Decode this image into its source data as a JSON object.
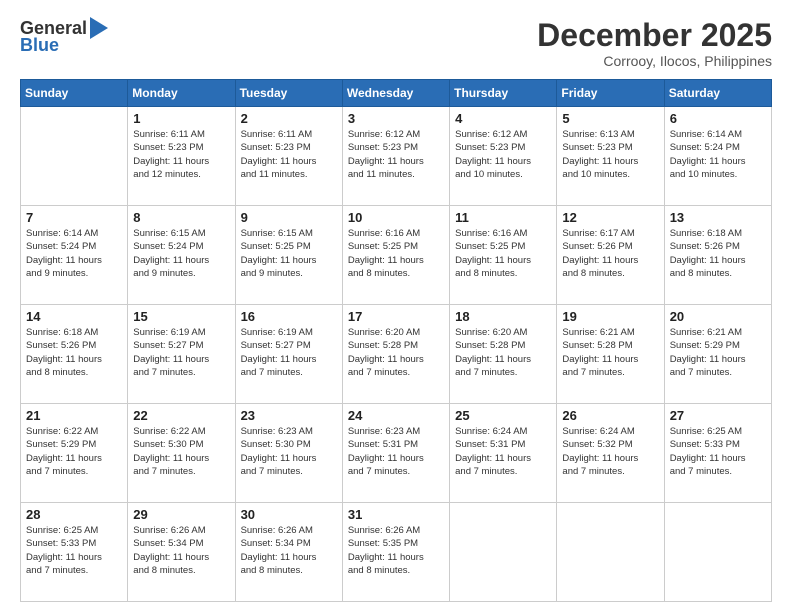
{
  "logo": {
    "general": "General",
    "blue": "Blue"
  },
  "header": {
    "month": "December 2025",
    "location": "Corrooy, Ilocos, Philippines"
  },
  "days_of_week": [
    "Sunday",
    "Monday",
    "Tuesday",
    "Wednesday",
    "Thursday",
    "Friday",
    "Saturday"
  ],
  "weeks": [
    [
      {
        "day": "",
        "info": ""
      },
      {
        "day": "1",
        "info": "Sunrise: 6:11 AM\nSunset: 5:23 PM\nDaylight: 11 hours\nand 12 minutes."
      },
      {
        "day": "2",
        "info": "Sunrise: 6:11 AM\nSunset: 5:23 PM\nDaylight: 11 hours\nand 11 minutes."
      },
      {
        "day": "3",
        "info": "Sunrise: 6:12 AM\nSunset: 5:23 PM\nDaylight: 11 hours\nand 11 minutes."
      },
      {
        "day": "4",
        "info": "Sunrise: 6:12 AM\nSunset: 5:23 PM\nDaylight: 11 hours\nand 10 minutes."
      },
      {
        "day": "5",
        "info": "Sunrise: 6:13 AM\nSunset: 5:23 PM\nDaylight: 11 hours\nand 10 minutes."
      },
      {
        "day": "6",
        "info": "Sunrise: 6:14 AM\nSunset: 5:24 PM\nDaylight: 11 hours\nand 10 minutes."
      }
    ],
    [
      {
        "day": "7",
        "info": "Sunrise: 6:14 AM\nSunset: 5:24 PM\nDaylight: 11 hours\nand 9 minutes."
      },
      {
        "day": "8",
        "info": "Sunrise: 6:15 AM\nSunset: 5:24 PM\nDaylight: 11 hours\nand 9 minutes."
      },
      {
        "day": "9",
        "info": "Sunrise: 6:15 AM\nSunset: 5:25 PM\nDaylight: 11 hours\nand 9 minutes."
      },
      {
        "day": "10",
        "info": "Sunrise: 6:16 AM\nSunset: 5:25 PM\nDaylight: 11 hours\nand 8 minutes."
      },
      {
        "day": "11",
        "info": "Sunrise: 6:16 AM\nSunset: 5:25 PM\nDaylight: 11 hours\nand 8 minutes."
      },
      {
        "day": "12",
        "info": "Sunrise: 6:17 AM\nSunset: 5:26 PM\nDaylight: 11 hours\nand 8 minutes."
      },
      {
        "day": "13",
        "info": "Sunrise: 6:18 AM\nSunset: 5:26 PM\nDaylight: 11 hours\nand 8 minutes."
      }
    ],
    [
      {
        "day": "14",
        "info": "Sunrise: 6:18 AM\nSunset: 5:26 PM\nDaylight: 11 hours\nand 8 minutes."
      },
      {
        "day": "15",
        "info": "Sunrise: 6:19 AM\nSunset: 5:27 PM\nDaylight: 11 hours\nand 7 minutes."
      },
      {
        "day": "16",
        "info": "Sunrise: 6:19 AM\nSunset: 5:27 PM\nDaylight: 11 hours\nand 7 minutes."
      },
      {
        "day": "17",
        "info": "Sunrise: 6:20 AM\nSunset: 5:28 PM\nDaylight: 11 hours\nand 7 minutes."
      },
      {
        "day": "18",
        "info": "Sunrise: 6:20 AM\nSunset: 5:28 PM\nDaylight: 11 hours\nand 7 minutes."
      },
      {
        "day": "19",
        "info": "Sunrise: 6:21 AM\nSunset: 5:28 PM\nDaylight: 11 hours\nand 7 minutes."
      },
      {
        "day": "20",
        "info": "Sunrise: 6:21 AM\nSunset: 5:29 PM\nDaylight: 11 hours\nand 7 minutes."
      }
    ],
    [
      {
        "day": "21",
        "info": "Sunrise: 6:22 AM\nSunset: 5:29 PM\nDaylight: 11 hours\nand 7 minutes."
      },
      {
        "day": "22",
        "info": "Sunrise: 6:22 AM\nSunset: 5:30 PM\nDaylight: 11 hours\nand 7 minutes."
      },
      {
        "day": "23",
        "info": "Sunrise: 6:23 AM\nSunset: 5:30 PM\nDaylight: 11 hours\nand 7 minutes."
      },
      {
        "day": "24",
        "info": "Sunrise: 6:23 AM\nSunset: 5:31 PM\nDaylight: 11 hours\nand 7 minutes."
      },
      {
        "day": "25",
        "info": "Sunrise: 6:24 AM\nSunset: 5:31 PM\nDaylight: 11 hours\nand 7 minutes."
      },
      {
        "day": "26",
        "info": "Sunrise: 6:24 AM\nSunset: 5:32 PM\nDaylight: 11 hours\nand 7 minutes."
      },
      {
        "day": "27",
        "info": "Sunrise: 6:25 AM\nSunset: 5:33 PM\nDaylight: 11 hours\nand 7 minutes."
      }
    ],
    [
      {
        "day": "28",
        "info": "Sunrise: 6:25 AM\nSunset: 5:33 PM\nDaylight: 11 hours\nand 7 minutes."
      },
      {
        "day": "29",
        "info": "Sunrise: 6:26 AM\nSunset: 5:34 PM\nDaylight: 11 hours\nand 8 minutes."
      },
      {
        "day": "30",
        "info": "Sunrise: 6:26 AM\nSunset: 5:34 PM\nDaylight: 11 hours\nand 8 minutes."
      },
      {
        "day": "31",
        "info": "Sunrise: 6:26 AM\nSunset: 5:35 PM\nDaylight: 11 hours\nand 8 minutes."
      },
      {
        "day": "",
        "info": ""
      },
      {
        "day": "",
        "info": ""
      },
      {
        "day": "",
        "info": ""
      }
    ]
  ]
}
